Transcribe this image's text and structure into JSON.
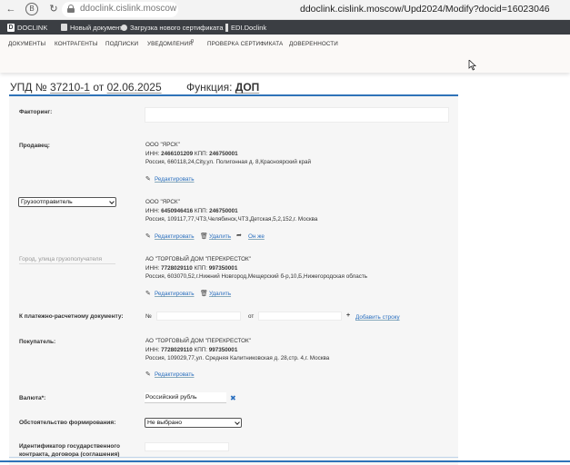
{
  "browser": {
    "url_short": "ddoclink.cislink.moscow",
    "url_full": "ddoclink.cislink.moscow/Upd2024/Modify?docid=16023046"
  },
  "appbar": {
    "logo_letter": "D",
    "brand": "DOCLINK",
    "new_doc": "Новый документ",
    "cert_upload": "Загрузка нового сертификата",
    "edi": "EDI.Doclink"
  },
  "nav": {
    "items": [
      "ДОКУМЕНТЫ",
      "КОНТРАГЕНТЫ",
      "ПОДПИСКИ",
      "УВЕДОМЛЕНИЯ",
      "ПРОВЕРКА СЕРТИФИКАТА",
      "ДОВЕРЕННОСТИ"
    ],
    "notifications_badge": "0"
  },
  "doc": {
    "prefix": "УПД №",
    "number": "37210-1",
    "date_prefix": "от",
    "date": "02.06.2025",
    "func_label": "Функция:",
    "func_value": "ДОП"
  },
  "form": {
    "factoring_label": "Факторинг:",
    "seller_label": "Продавец:",
    "seller": {
      "name": "ООО \"ЯРСК\"",
      "inn_label": "ИНН:",
      "inn": "2466101209",
      "kpp_label": "КПП:",
      "kpp": "246750001",
      "address": "Россия, 660118,24,City,ул. Полигонная д. 8,Красноярский край"
    },
    "edit": "Редактировать",
    "delete": "Удалить",
    "same": "Он же",
    "shipper_select": "Грузоотправитель",
    "shipper": {
      "name": "ООО \"ЯРСК\"",
      "inn_label": "ИНН:",
      "inn": "6450946416",
      "kpp_label": "КПП:",
      "kpp": "246750001",
      "address": "Россия, 109117,77,ЧТЗ,Челябинск,ЧТЗ,Детская,5,2,152,г. Москва"
    },
    "consignee_placeholder": "Город, улица грузополучателя",
    "consignee": {
      "name": "АО \"ТОРГОВЫЙ ДОМ \"ПЕРЕКРЕСТОК\"",
      "inn_label": "ИНН:",
      "inn": "7728029110",
      "kpp_label": "КПП:",
      "kpp": "997350001",
      "address": "Россия, 603070,52,г.Нижний Новгород,Мещерский б-р,10,Б,Нижегородская область"
    },
    "payment_label": "К платежно-расчетному документу:",
    "payment_no": "№",
    "payment_from": "от",
    "add_row": "Добавить строку",
    "buyer_label": "Покупатель:",
    "buyer": {
      "name": "АО \"ТОРГОВЫЙ ДОМ \"ПЕРЕКРЕСТОК\"",
      "inn_label": "ИНН:",
      "inn": "7728029110",
      "kpp_label": "КПП:",
      "kpp": "997350001",
      "address": "Россия, 109029,77,ул. Средняя Калитниковская д. 28,стр. 4,г. Москва"
    },
    "currency_label": "Валюта*:",
    "currency_value": "Российский рубль",
    "circumstance_label": "Обстоятельство формирования:",
    "circumstance_value": "Не выбрано",
    "gov_id_label": "Идентификатор государственного контракта, договора (соглашения)"
  }
}
